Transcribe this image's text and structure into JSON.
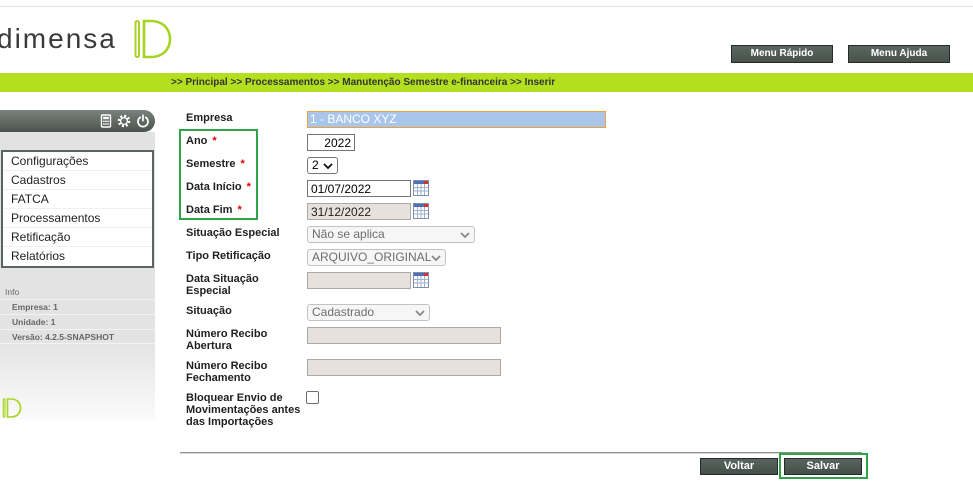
{
  "logo": {
    "text": "dimensa"
  },
  "header": {
    "menu_rapido": "Menu Rápido",
    "menu_ajuda": "Menu Ajuda"
  },
  "breadcrumb": {
    "separator": ">>",
    "items": [
      "Principal",
      "Processamentos",
      "Manutenção Semestre e-financeira",
      "Inserir"
    ]
  },
  "sidebar": {
    "toolbar_icons": [
      "calculator-icon",
      "gear-icon",
      "power-icon"
    ],
    "menu": [
      "Configurações",
      "Cadastros",
      "FATCA",
      "Processamentos",
      "Retificação",
      "Relatórios"
    ],
    "info": {
      "title": "Info",
      "items": [
        "Empresa: 1",
        "Unidade: 1",
        "Versão: 4.2.5-SNAPSHOT"
      ]
    }
  },
  "form": {
    "required_mark": "*",
    "fields": {
      "empresa": {
        "label": "Empresa",
        "value": "1 - BANCO XYZ",
        "focused": true
      },
      "ano": {
        "label": "Ano",
        "value": "2022",
        "required": true
      },
      "semestre": {
        "label": "Semestre",
        "value": "2",
        "required": true
      },
      "data_inicio": {
        "label": "Data Início",
        "value": "01/07/2022",
        "required": true
      },
      "data_fim": {
        "label": "Data Fim",
        "value": "31/12/2022",
        "required": true,
        "disabled": true
      },
      "situacao_especial": {
        "label": "Situação Especial",
        "value": "Não se aplica",
        "disabled": true
      },
      "tipo_retificacao": {
        "label": "Tipo Retificação",
        "value": "ARQUIVO_ORIGINAL",
        "disabled": true
      },
      "data_situacao_especial": {
        "label": "Data Situação\nEspecial",
        "value": "",
        "disabled": true
      },
      "situacao": {
        "label": "Situação",
        "value": "Cadastrado",
        "disabled": true
      },
      "numero_recibo_abertura": {
        "label": "Número Recibo\nAbertura",
        "value": "",
        "disabled": true
      },
      "numero_recibo_fechamento": {
        "label": "Número Recibo\nFechamento",
        "value": "",
        "disabled": true
      },
      "bloquear_envio": {
        "label": "Bloquear Envio de\nMovimentações antes\ndas Importações",
        "checked": false
      }
    }
  },
  "actions": {
    "voltar": "Voltar",
    "salvar": "Salvar"
  },
  "icons": {
    "calendar": "calendar-icon",
    "dropdown": "chevron-down-icon",
    "logo": "dimensa-logo-icon"
  },
  "colors": {
    "brand_green": "#b3df1f",
    "logo_green": "#a7d421",
    "highlight_green": "#2fa24a",
    "required_red": "#e00000",
    "focus_orange": "#eaa23a",
    "button_dark": "#4f5a54",
    "disabled_field": "#e7e0db"
  }
}
